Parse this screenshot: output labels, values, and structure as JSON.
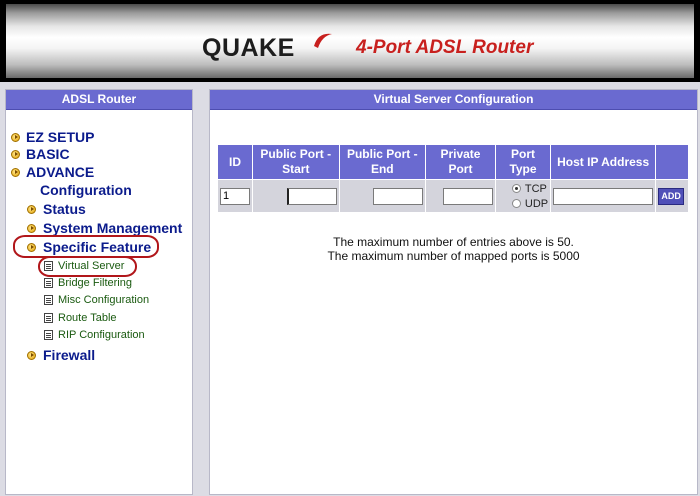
{
  "banner": {
    "brand": "QUAKE",
    "product": "4-Port ADSL Router",
    "colors": {
      "brand": "#1d1d1d",
      "product": "#c8201e"
    }
  },
  "sidebar": {
    "title": "ADSL Router",
    "items": [
      {
        "label": "EZ SETUP",
        "icon": "arrow-bullet-icon"
      },
      {
        "label": "BASIC",
        "icon": "arrow-bullet-icon"
      },
      {
        "label": "ADVANCE",
        "icon": "arrow-bullet-icon"
      },
      {
        "label": "Configuration"
      },
      {
        "label": "Status",
        "icon": "arrow-bullet-icon"
      },
      {
        "label": "System Management",
        "icon": "arrow-bullet-icon"
      },
      {
        "label": "Specific Feature",
        "icon": "arrow-bullet-icon"
      },
      {
        "label": "Virtual Server",
        "icon": "document-icon"
      },
      {
        "label": "Bridge Filtering",
        "icon": "document-icon"
      },
      {
        "label": "Misc Configuration",
        "icon": "document-icon"
      },
      {
        "label": "Route Table",
        "icon": "document-icon"
      },
      {
        "label": "RIP Configuration",
        "icon": "document-icon"
      },
      {
        "label": "Firewall",
        "icon": "arrow-bullet-icon"
      }
    ],
    "colors": {
      "header": "#6a6ad0",
      "link": "#0b1b8c",
      "sublink": "#1a5a10",
      "annotation": "#b1161a"
    }
  },
  "main": {
    "title": "Virtual Server Configuration",
    "table": {
      "headers": [
        "ID",
        "Public Port - Start",
        "Public Port - End",
        "Private Port",
        "Port Type",
        "Host IP Address",
        ""
      ],
      "row": {
        "id": "1",
        "public_start": "",
        "public_end": "",
        "private_port": "",
        "port_type_options": [
          "TCP",
          "UDP"
        ],
        "port_type_selected": "TCP",
        "host_ip": "",
        "add_label": "ADD"
      }
    },
    "notes": [
      "The maximum number of entries above is 50.",
      "The maximum number of mapped ports is 5000"
    ]
  }
}
